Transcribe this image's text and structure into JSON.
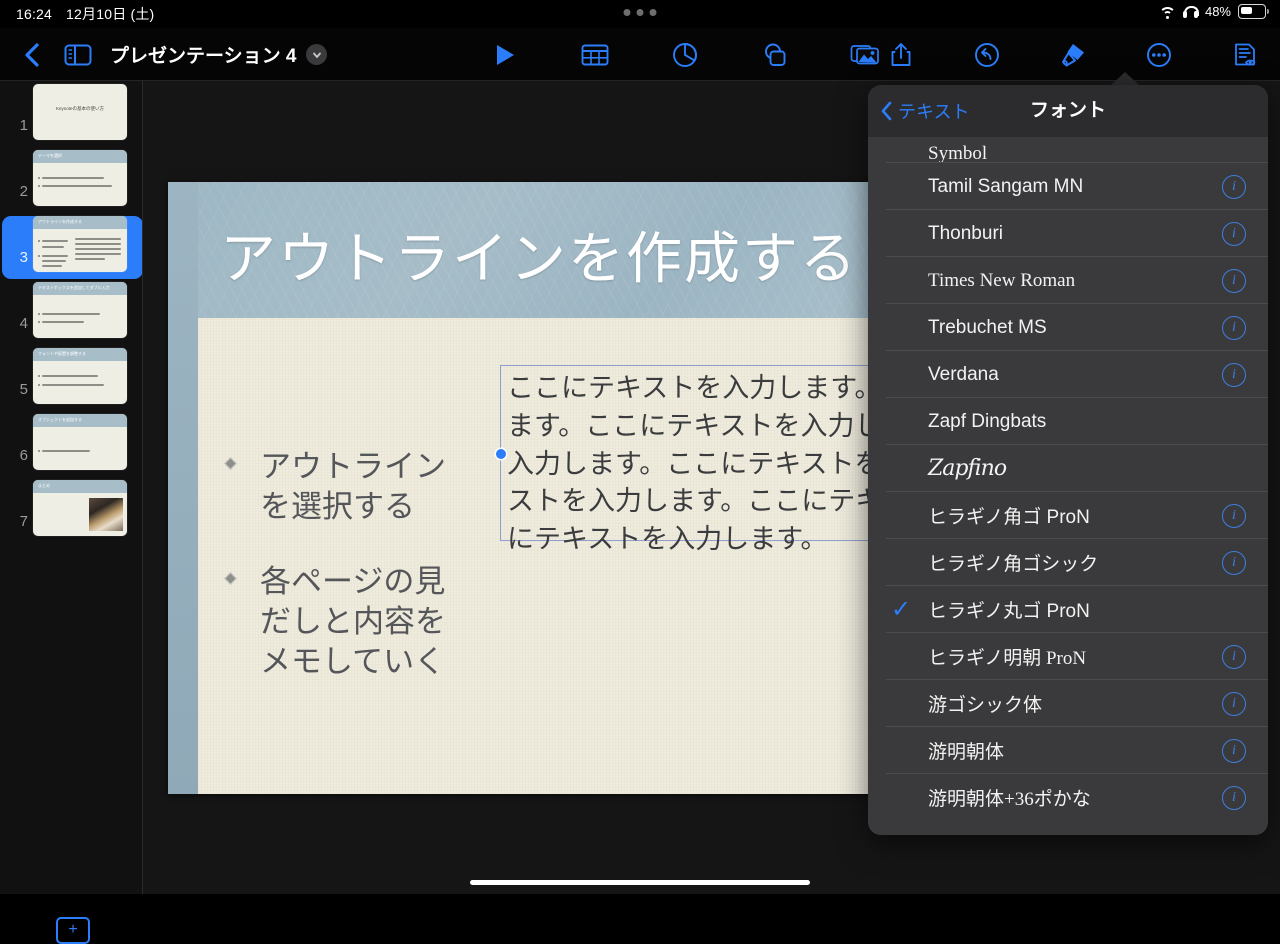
{
  "status_bar": {
    "time": "16:24",
    "date": "12月10日 (土)",
    "battery_percent": "48%",
    "wifi_icon": "wifi-icon",
    "headphones_icon": "headphones-icon",
    "battery_icon": "battery-icon",
    "multitask_dots": "multitask-handle-icon"
  },
  "toolbar": {
    "back_icon": "chevron-left-icon",
    "sidebar_toggle_icon": "sidebar-toggle-icon",
    "document_title": "プレゼンテーション 4",
    "title_chevron_icon": "chevron-down-icon",
    "center_tools": [
      {
        "name": "play-button",
        "icon": "play-icon"
      },
      {
        "name": "insert-table-button",
        "icon": "table-icon"
      },
      {
        "name": "insert-chart-button",
        "icon": "pie-chart-icon"
      },
      {
        "name": "insert-shape-button",
        "icon": "shapes-icon"
      },
      {
        "name": "insert-media-button",
        "icon": "media-icon"
      }
    ],
    "right_tools": [
      {
        "name": "share-button",
        "icon": "share-icon"
      },
      {
        "name": "undo-button",
        "icon": "undo-icon"
      },
      {
        "name": "format-button",
        "icon": "paintbrush-icon"
      },
      {
        "name": "more-button",
        "icon": "ellipsis-icon"
      },
      {
        "name": "presenter-notes-button",
        "icon": "document-eye-icon"
      }
    ]
  },
  "sidebar": {
    "add_slide_label": "+",
    "slides": [
      {
        "number": "1",
        "title": "Keynoteの基本の使い方",
        "selected": false,
        "layout": "title-only"
      },
      {
        "number": "2",
        "title": "テーマを選択",
        "selected": false,
        "layout": "bullets"
      },
      {
        "number": "3",
        "title": "アウトラインを作成する",
        "selected": true,
        "layout": "bullets-text"
      },
      {
        "number": "4",
        "title": "テキストボックスを追加してダブル入力",
        "selected": false,
        "layout": "bullets"
      },
      {
        "number": "5",
        "title": "フォントや配置を調整する",
        "selected": false,
        "layout": "bullets"
      },
      {
        "number": "6",
        "title": "オブジェクトを追加する",
        "selected": false,
        "layout": "bullets"
      },
      {
        "number": "7",
        "title": "まとめ",
        "selected": false,
        "layout": "image"
      }
    ]
  },
  "slide": {
    "title": "アウトラインを作成する",
    "bullets": [
      "アウトライン\nを選択する",
      "各ページの見\nだしと内容を\nメモしていく"
    ],
    "textbox": {
      "content": "ここにテキストを入力します。\nます。ここにテキストを入力し\n入力します。ここにテキストを\nストを入力します。ここにテキ\nにテキストを入力します。",
      "selected": true
    }
  },
  "font_panel": {
    "back_label": "テキスト",
    "back_icon": "chevron-left-icon",
    "title": "フォント",
    "accent_color": "#2b7dfa",
    "background_color": "#3a3a3c",
    "fonts": [
      {
        "name": "Symbol",
        "info": false,
        "checked": false,
        "clipped": true,
        "style": "serif"
      },
      {
        "name": "Tamil Sangam MN",
        "info": true,
        "checked": false,
        "style": "sans"
      },
      {
        "name": "Thonburi",
        "info": true,
        "checked": false,
        "style": "sans"
      },
      {
        "name": "Times New Roman",
        "info": true,
        "checked": false,
        "style": "serif"
      },
      {
        "name": "Trebuchet MS",
        "info": true,
        "checked": false,
        "style": "sans"
      },
      {
        "name": "Verdana",
        "info": true,
        "checked": false,
        "style": "sans"
      },
      {
        "name": "Zapf Dingbats",
        "info": false,
        "checked": false,
        "style": "sans"
      },
      {
        "name": "Zapfino",
        "info": false,
        "checked": false,
        "style": "script"
      },
      {
        "name": "ヒラギノ角ゴ ProN",
        "info": true,
        "checked": false,
        "style": "sans"
      },
      {
        "name": "ヒラギノ角ゴシック",
        "info": true,
        "checked": false,
        "style": "sans"
      },
      {
        "name": "ヒラギノ丸ゴ ProN",
        "info": false,
        "checked": true,
        "style": "sans"
      },
      {
        "name": "ヒラギノ明朝 ProN",
        "info": true,
        "checked": false,
        "style": "serif"
      },
      {
        "name": "游ゴシック体",
        "info": true,
        "checked": false,
        "style": "sans"
      },
      {
        "name": "游明朝体",
        "info": true,
        "checked": false,
        "style": "serif"
      },
      {
        "name": "游明朝体+36ポかな",
        "info": true,
        "checked": false,
        "style": "serif"
      }
    ]
  }
}
